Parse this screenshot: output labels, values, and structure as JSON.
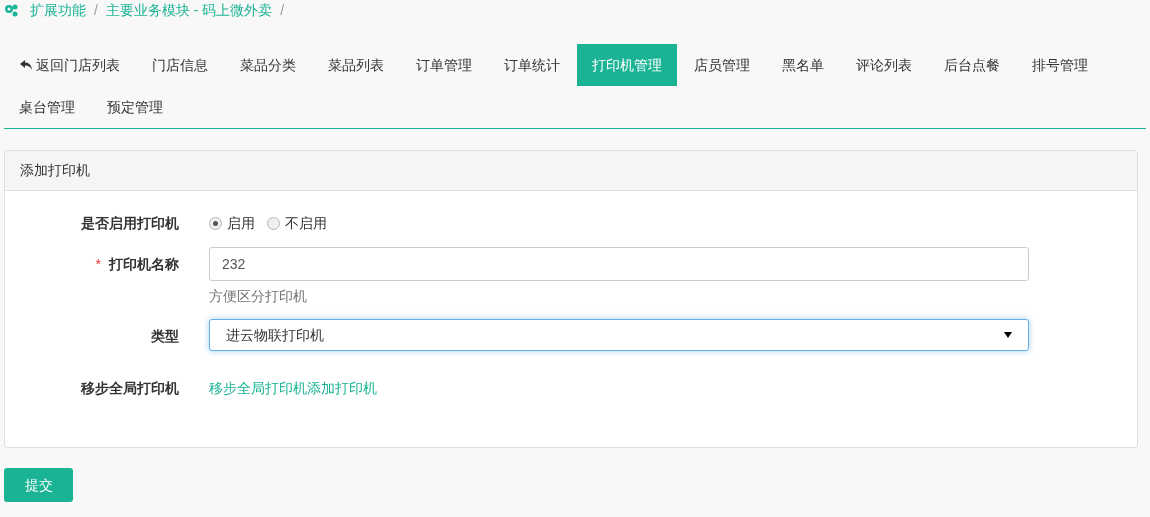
{
  "breadcrumb": [
    {
      "label": "扩展功能",
      "separator": "/"
    },
    {
      "label": "主要业务模块 - 码上微外卖",
      "separator": "/"
    }
  ],
  "tabs": [
    {
      "label": "返回门店列表",
      "kind": "back",
      "selected": false
    },
    {
      "label": "门店信息",
      "selected": false
    },
    {
      "label": "菜品分类",
      "selected": false
    },
    {
      "label": "菜品列表",
      "selected": false
    },
    {
      "label": "订单管理",
      "selected": false
    },
    {
      "label": "订单统计",
      "selected": false
    },
    {
      "label": "打印机管理",
      "selected": true
    },
    {
      "label": "店员管理",
      "selected": false
    },
    {
      "label": "黑名单",
      "selected": false
    },
    {
      "label": "评论列表",
      "selected": false
    },
    {
      "label": "后台点餐",
      "selected": false
    },
    {
      "label": "排号管理",
      "selected": false
    },
    {
      "label": "桌台管理",
      "selected": false
    },
    {
      "label": "预定管理",
      "selected": false
    }
  ],
  "panel": {
    "title": "添加打印机",
    "fields": [
      {
        "kind": "radio",
        "label": "是否启用打印机",
        "options": [
          {
            "label": "启用",
            "selected": true
          },
          {
            "label": "不启用",
            "selected": false
          }
        ]
      },
      {
        "kind": "text",
        "label": "打印机名称",
        "required_mark": "*",
        "value": "232",
        "help": "方便区分打印机"
      },
      {
        "kind": "select",
        "label": "类型",
        "value": "进云物联打印机"
      },
      {
        "kind": "link",
        "label": "移步全局打印机",
        "link": "移步全局打印机添加打印机"
      }
    ]
  },
  "submit": "提交"
}
